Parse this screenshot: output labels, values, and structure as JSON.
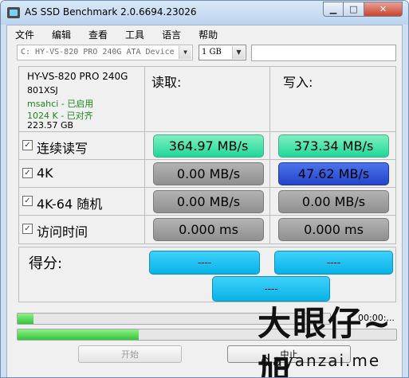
{
  "window": {
    "title": "AS SSD Benchmark 2.0.6694.23026",
    "close_glyph": "✕",
    "min_glyph": "▁",
    "max_glyph": "□"
  },
  "menu": [
    "文件",
    "编辑",
    "查看",
    "工具",
    "语言",
    "帮助"
  ],
  "drive": {
    "selected": "C: HY-VS-820 PRO 240G ATA Device",
    "size": "1 GB",
    "note": ""
  },
  "info": {
    "model": "HY-VS-820 PRO 240G",
    "firmware": "801XSJ",
    "driver": "msahci - 已启用",
    "alignment": "1024 K - 已对齐",
    "capacity": "223.57 GB",
    "ok_color": "#1a8a1a"
  },
  "headers": {
    "read": "读取:",
    "write": "写入:"
  },
  "rows": [
    {
      "label": "连续读写",
      "checked": true,
      "read": "364.97 MB/s",
      "write": "373.34 MB/s",
      "read_style": "green",
      "write_style": "green"
    },
    {
      "label": "4K",
      "checked": true,
      "read": "0.00 MB/s",
      "write": "47.62 MB/s",
      "read_style": "gray",
      "write_style": "blue"
    },
    {
      "label": "4K-64 随机",
      "checked": true,
      "read": "0.00 MB/s",
      "write": "0.00 MB/s",
      "read_style": "gray",
      "write_style": "gray"
    },
    {
      "label": "访问时间",
      "checked": true,
      "read": "0.000 ms",
      "write": "0.000 ms",
      "read_style": "gray",
      "write_style": "gray"
    }
  ],
  "score": {
    "label": "得分:",
    "read": "----",
    "write": "----",
    "total": "----"
  },
  "progress": {
    "top_fraction": 0.05,
    "bottom_fraction": 0.32,
    "time": "00:00:..."
  },
  "buttons": {
    "start": "开始",
    "stop": "中止"
  },
  "watermark": {
    "text": "大眼仔~旭",
    "url": "dayanzai.me"
  },
  "colors": {
    "accent_green": "#1fd79a",
    "accent_blue": "#2445c9",
    "score_blue": "#08b2e7",
    "progress_green": "#33c43a"
  }
}
